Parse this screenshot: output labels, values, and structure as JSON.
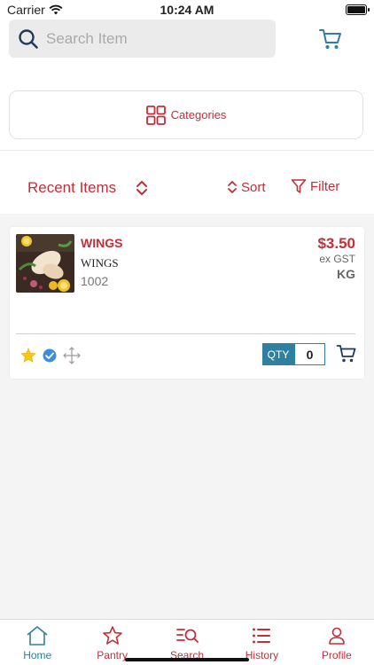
{
  "status": {
    "carrier": "Carrier",
    "time": "10:24 AM"
  },
  "search": {
    "placeholder": "Search Item"
  },
  "categories": {
    "label": "Categories"
  },
  "list_controls": {
    "title": "Recent Items",
    "sort_label": "Sort",
    "filter_label": "Filter"
  },
  "item": {
    "name": "WINGS",
    "description": "WINGS",
    "code": "1002",
    "price": "$3.50",
    "tax_note": "ex GST",
    "unit": "KG",
    "qty_label": "QTY",
    "qty_value": "0"
  },
  "tabs": [
    {
      "label": "Home",
      "icon": "home-icon",
      "active": true
    },
    {
      "label": "Pantry",
      "icon": "star-icon",
      "active": false
    },
    {
      "label": "Search",
      "icon": "search-list-icon",
      "active": false
    },
    {
      "label": "History",
      "icon": "list-icon",
      "active": false
    },
    {
      "label": "Profile",
      "icon": "person-icon",
      "active": false
    }
  ],
  "colors": {
    "accent_red": "#c0303a",
    "accent_blue": "#2f7fa0",
    "background": "#f4f4f4"
  }
}
